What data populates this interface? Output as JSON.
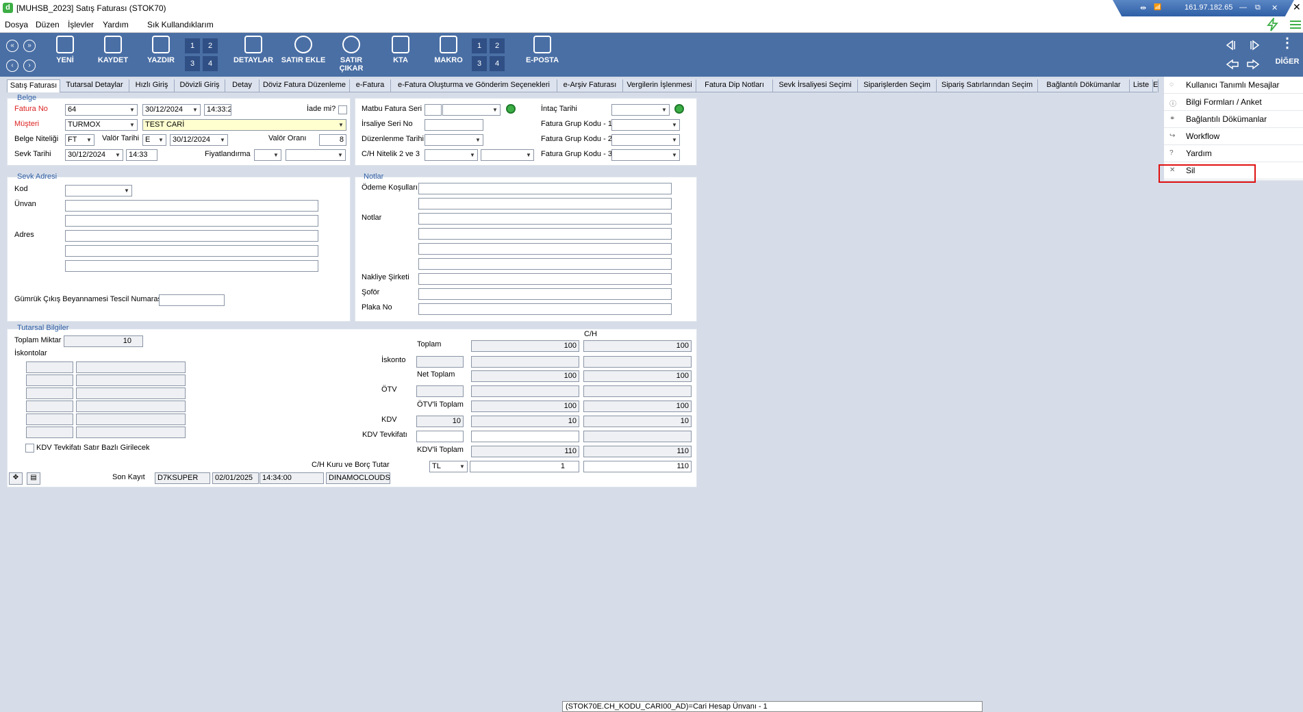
{
  "window": {
    "title": "[MUHSB_2023] Satış Faturası (STOK70)",
    "close": "✕",
    "logo": "d"
  },
  "remote": {
    "icon1": "⇹",
    "icon2": "📶",
    "ip": "161.97.182.65",
    "min": "—",
    "restore": "⧉",
    "close": "✕"
  },
  "menu": [
    "Dosya",
    "Düzen",
    "İşlevler",
    "Yardım",
    "Sık Kullandıklarım"
  ],
  "toolbar": {
    "new": "YENİ",
    "save": "KAYDET",
    "print": "YAZDIR",
    "details": "DETAYLAR",
    "add_row": "SATIR EKLE",
    "remove_row": "SATIR ÇIKAR",
    "kta": "KTA",
    "macro": "MAKRO",
    "email": "E-POSTA",
    "more": "DİĞER",
    "pages": [
      "1",
      "2",
      "3",
      "4"
    ],
    "nav": [
      "«",
      "»",
      "‹",
      "›"
    ],
    "more_dots": "⋮"
  },
  "tabs": [
    "Satış Faturası",
    "Tutarsal Detaylar",
    "Hızlı Giriş",
    "Dövizli Giriş",
    "Detay",
    "Döviz Fatura Düzenleme",
    "e-Fatura",
    "e-Fatura Oluşturma ve Gönderim Seçenekleri",
    "e-Arşiv Faturası",
    "Vergilerin İşlenmesi",
    "Fatura Dip Notları",
    "Sevk İrsaliyesi Seçimi",
    "Siparişlerden Seçim",
    "Sipariş Satırlarından Seçim",
    "Bağlantılı Dökümanlar",
    "Liste",
    "E"
  ],
  "belge": {
    "legend": "Belge",
    "fatura_no_label": "Fatura No",
    "fatura_no": "64",
    "fatura_date": "30/12/2024",
    "fatura_time": "14:33:2",
    "iade_label": "İade mi?",
    "musteri_label": "Müşteri",
    "musteri": "TURMOX",
    "musteri_name": "TEST CARİ",
    "belge_niteligi_label": "Belge Niteliği",
    "belge_niteligi": "FT",
    "valor_tarihi_label": "Valör Tarihi",
    "valor_flag": "E",
    "valor_date": "30/12/2024",
    "valor_orani_label": "Valör Oranı",
    "valor_orani": "8",
    "sevk_tarihi_label": "Sevk Tarihi",
    "sevk_date": "30/12/2024",
    "sevk_time": "14:33",
    "fiyatlandirma_label": "Fiyatlandırma"
  },
  "right_top": {
    "matbu_label": "Matbu Fatura Seri - Sıra",
    "irsaliye_label": "İrsaliye Seri No",
    "duzenlenme_label": "Düzenlenme Tarihi",
    "ch_nitelik_label": "C/H Nitelik 2 ve 3",
    "intac_label": "İntaç Tarihi",
    "grup1_label": "Fatura Grup Kodu - 1",
    "grup2_label": "Fatura Grup Kodu - 2",
    "grup3_label": "Fatura Grup Kodu - 3"
  },
  "sevk": {
    "legend": "Sevk Adresi",
    "kod_label": "Kod",
    "unvan_label": "Ünvan",
    "adres_label": "Adres",
    "gumruk_label": "Gümrük Çıkış Beyannamesi Tescil Numarası"
  },
  "notlar": {
    "legend": "Notlar",
    "odeme_label": "Ödeme Koşulları",
    "notlar_label": "Notlar",
    "nakliye_label": "Nakliye Şirketi",
    "sofor_label": "Şoför",
    "plaka_label": "Plaka No"
  },
  "tutarsal": {
    "legend": "Tutarsal Bilgiler",
    "toplam_miktar_label": "Toplam Miktar",
    "toplam_miktar": "10",
    "iskontolar_label": "İskontolar",
    "kdv_tevkifat_check_label": "KDV Tevkifatı Satır Bazlı Girilecek",
    "ch_header": "C/H",
    "toplam_label": "Toplam",
    "toplam": "100",
    "toplam_ch": "100",
    "iskonto_label": "İskonto",
    "net_toplam_label": "Net Toplam",
    "net_toplam": "100",
    "net_toplam_ch": "100",
    "otv_label": "ÖTV",
    "otvli_toplam_label": "ÖTV'li Toplam",
    "otvli_toplam": "100",
    "otvli_toplam_ch": "100",
    "kdv_label": "KDV",
    "kdv_rate": "10",
    "kdv": "10",
    "kdv_ch": "10",
    "kdv_tevkifati_label": "KDV Tevkifatı",
    "kdvli_toplam_label": "KDV'li Toplam",
    "kdvli_toplam": "110",
    "kdvli_toplam_ch": "110",
    "ch_kuru_label": "C/H Kuru ve Borç Tutar",
    "currency": "TL",
    "kur": "1",
    "borc": "110"
  },
  "son_kayit": {
    "label": "Son Kayıt",
    "user": "D7KSUPER",
    "date": "02/01/2025",
    "time": "14:34:00",
    "host": "DINAMOCLOUDS"
  },
  "context_menu": [
    {
      "icon": "message-icon",
      "glyph": "◌",
      "label": "Kullanıcı Tanımlı Mesajlar"
    },
    {
      "icon": "info-icon",
      "glyph": "ⓘ",
      "label": "Bilgi Formları / Anket"
    },
    {
      "icon": "link-icon",
      "glyph": "⚭",
      "label": "Bağlantılı Dökümanlar"
    },
    {
      "icon": "workflow-icon",
      "glyph": "↪",
      "label": "Workflow"
    },
    {
      "icon": "help-icon",
      "glyph": "?",
      "label": "Yardım"
    },
    {
      "icon": "close-icon",
      "glyph": "✕",
      "label": "Sil"
    }
  ],
  "status": "(STOK70E.CH_KODU_CARI00_AD)=Cari Hesap Ünvanı - 1",
  "colors": {
    "toolbar": "#4a6fa5",
    "accent": "#2f5fa6",
    "highlight": "#e01010",
    "green": "#3cae45"
  }
}
